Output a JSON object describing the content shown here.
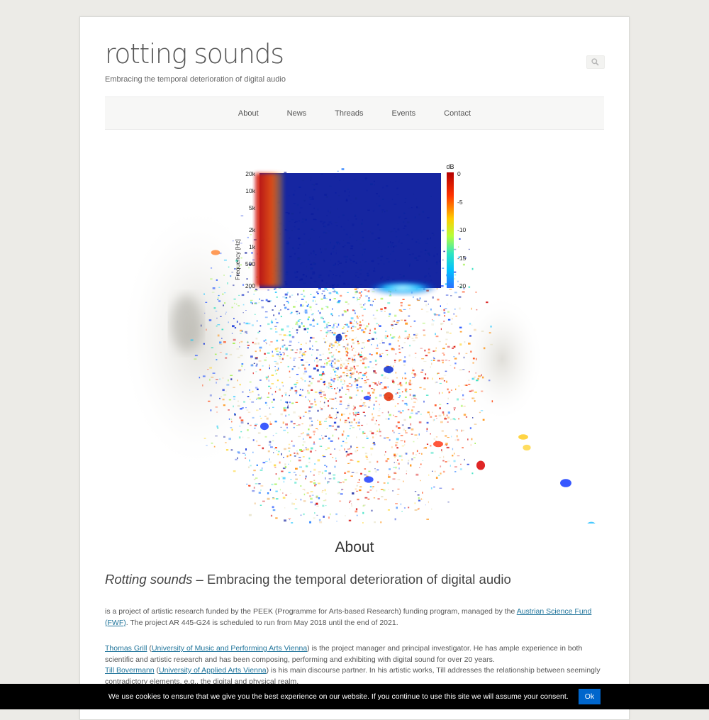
{
  "site": {
    "title": "rotting sounds",
    "tagline": "Embracing the temporal deterioration of digital audio"
  },
  "nav": {
    "items": [
      "About",
      "News",
      "Threads",
      "Events",
      "Contact"
    ]
  },
  "hero": {
    "colorbar_unit": "dB",
    "colorbar_ticks": [
      "0",
      "-5",
      "-10",
      "-15",
      "-20"
    ],
    "axis_label": "Frequency [Hz]",
    "freq_ticks": [
      "20k",
      "10k",
      "5k",
      "2k",
      "1k",
      "500",
      "200"
    ]
  },
  "content": {
    "heading": "About",
    "subheading_italic": "Rotting sounds",
    "subheading_rest": " – Embracing the temporal deterioration of digital audio",
    "p1_text": "is a project of artistic research funded by the PEEK (Programme for Arts-based Research) funding program, managed by the ",
    "p1_link": "Austrian Science Fund (FWF)",
    "p1_end": ". The project AR 445-G24 is scheduled to run from May 2018 until the end of 2021.",
    "p2_link1": "Thomas Grill",
    "p2_paren_open": " (",
    "p2_link2": "University of Music and Performing Arts Vienna",
    "p2_text": ") is the project manager and principal investigator. He has ample experience in both scientific and artistic research and has been composing, performing and exhibiting with digital sound for over 20 years.",
    "p3_link1": "Till Bovermann",
    "p3_paren_open": " (",
    "p3_link2": "University of Applied Arts Vienna",
    "p3_text": ") is his main discourse partner. In his artistic works, Till addresses the relationship between seemingly contradictory elements, e.g., the digital and physical realm."
  },
  "cookie": {
    "message": "We use cookies to ensure that we give you the best experience on our website. If you continue to use this site we will assume your consent.",
    "ok_label": "Ok"
  },
  "colors": {
    "link": "#21759b",
    "cookie_button": "#0066cc"
  }
}
